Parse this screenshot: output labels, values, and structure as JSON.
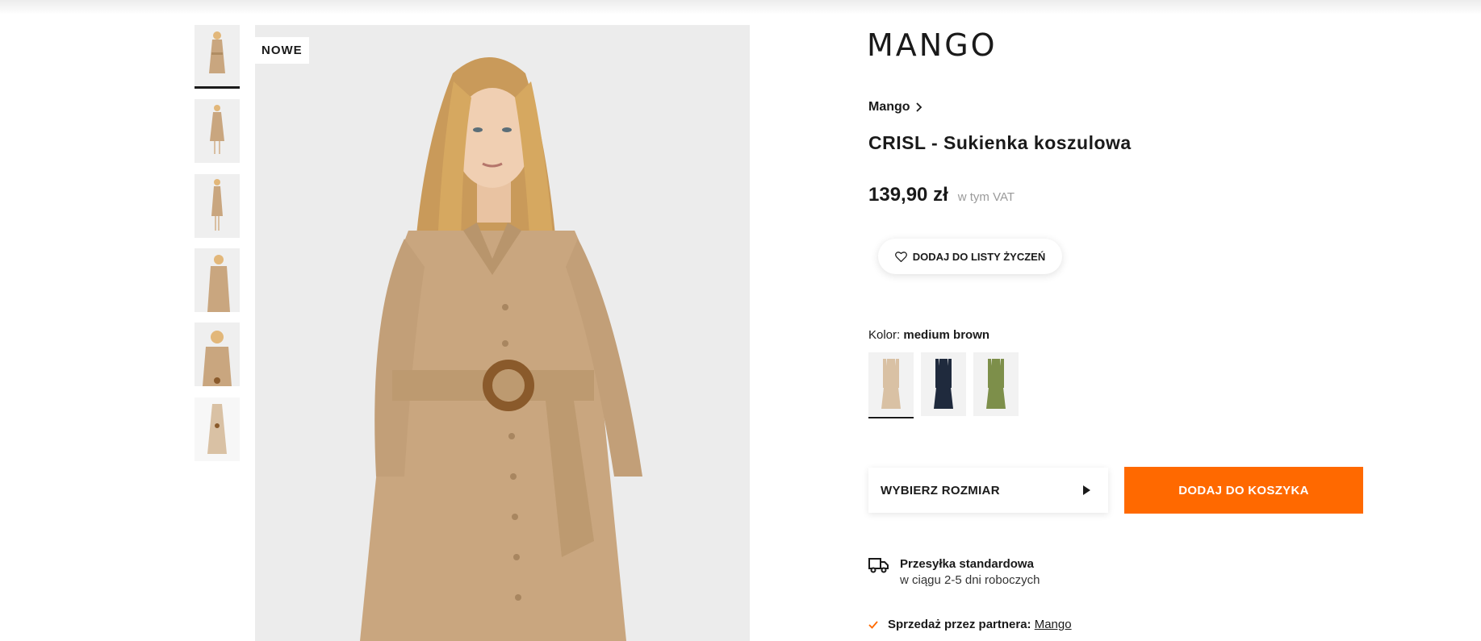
{
  "gallery": {
    "badge": "NOWE",
    "thumbnails": [
      {
        "alt": "product-photo-1"
      },
      {
        "alt": "product-photo-2"
      },
      {
        "alt": "product-photo-3"
      },
      {
        "alt": "product-photo-4"
      },
      {
        "alt": "product-photo-5"
      },
      {
        "alt": "product-photo-6"
      }
    ]
  },
  "product": {
    "brand_logo": "MANGO",
    "breadcrumb": "Mango",
    "title": "CRISL - Sukienka koszulowa",
    "price": "139,90 zł",
    "vat_note": "w tym VAT",
    "wishlist_label": "DODAJ DO LISTY ŻYCZEŃ",
    "color_prefix": "Kolor:",
    "color_name": "medium brown",
    "swatches": [
      {
        "name": "medium brown",
        "color": "#d9c1a4"
      },
      {
        "name": "navy",
        "color": "#1f2a3d"
      },
      {
        "name": "green",
        "color": "#7d8f4a"
      }
    ],
    "size_label": "WYBIERZ ROZMIAR",
    "add_to_cart_label": "DODAJ DO KOSZYKA"
  },
  "shipping": {
    "title": "Przesyłka standardowa",
    "subtitle": "w ciągu 2-5 dni roboczych"
  },
  "partner": {
    "prefix": "Sprzedaż przez partnera:",
    "link": "Mango"
  },
  "colors": {
    "accent": "#ff6900",
    "dress": "#c9a67f",
    "text": "#1a1a1a"
  }
}
